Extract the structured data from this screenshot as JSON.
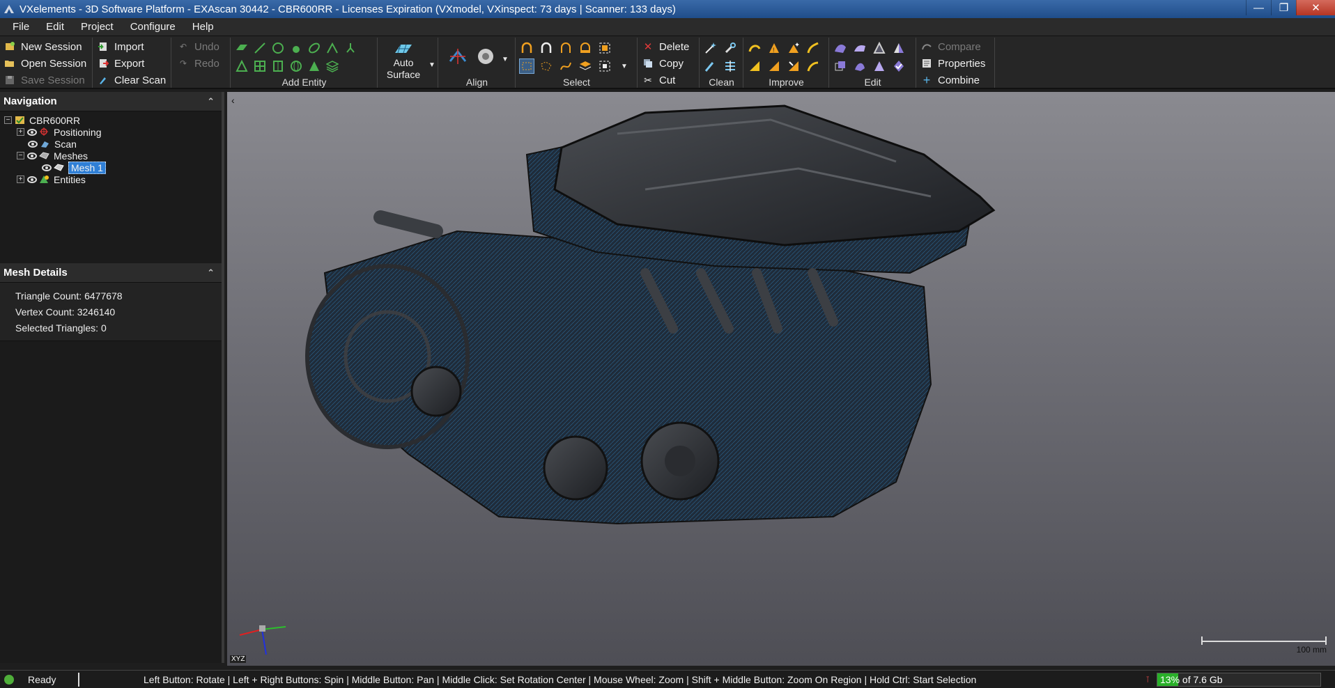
{
  "window": {
    "title": "VXelements - 3D Software Platform - EXAscan 30442 - CBR600RR - Licenses Expiration (VXmodel, VXinspect: 73 days | Scanner: 133 days)"
  },
  "menu": [
    "File",
    "Edit",
    "Project",
    "Configure",
    "Help"
  ],
  "ribbon": {
    "session": {
      "new": "New Session",
      "open": "Open Session",
      "save": "Save Session"
    },
    "file": {
      "import": "Import",
      "export": "Export",
      "clear_scan": "Clear Scan"
    },
    "history": {
      "undo": "Undo",
      "redo": "Redo"
    },
    "add_entity_label": "Add Entity",
    "auto_surface_label": "Auto\nSurface",
    "align_label": "Align",
    "select_label": "Select",
    "clipboard": {
      "delete": "Delete",
      "copy": "Copy",
      "cut": "Cut"
    },
    "clean_label": "Clean",
    "improve_label": "Improve",
    "edit_label": "Edit",
    "mesh_ops": {
      "compare": "Compare",
      "properties": "Properties",
      "combine": "Combine"
    }
  },
  "navigation": {
    "title": "Navigation",
    "root": "CBR600RR",
    "items": [
      "Positioning",
      "Scan",
      "Meshes",
      "Mesh 1",
      "Entities"
    ]
  },
  "mesh_details": {
    "title": "Mesh Details",
    "lines": [
      "Triangle Count: 6477678",
      "Vertex Count: 3246140",
      "Selected Triangles: 0"
    ]
  },
  "viewport": {
    "axis_label": "XYZ",
    "scale_label": "100 mm"
  },
  "status": {
    "state": "Ready",
    "help": "Left Button: Rotate  |  Left + Right Buttons: Spin  |  Middle Button: Pan  |  Middle Click: Set Rotation Center  |  Mouse Wheel: Zoom  |  Shift + Middle Button: Zoom On Region  |  Hold Ctrl: Start Selection",
    "memory_text": "13% of 7.6 Gb",
    "memory_fraction": 0.13
  },
  "colors": {
    "accent": "#2f7fd6",
    "memory_fill": "#29b029",
    "mesh_tint": "#2a5e86"
  }
}
